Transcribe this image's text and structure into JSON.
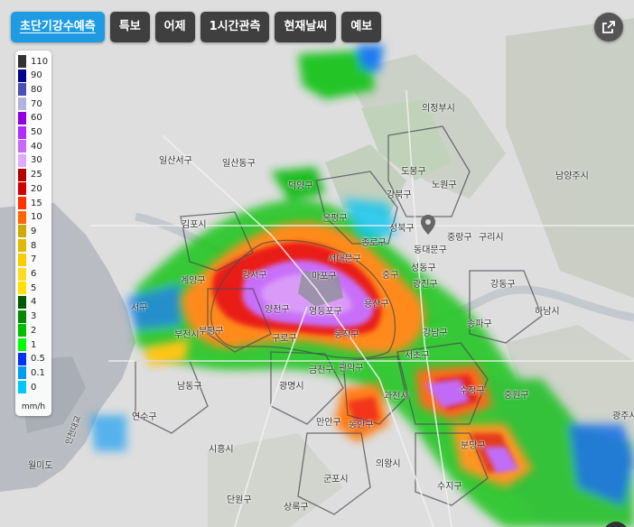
{
  "tabs": [
    {
      "label": "초단기강수예측",
      "active": true
    },
    {
      "label": "특보",
      "active": false
    },
    {
      "label": "어제",
      "active": false
    },
    {
      "label": "1시간관측",
      "active": false
    },
    {
      "label": "현재날씨",
      "active": false
    },
    {
      "label": "예보",
      "active": false
    }
  ],
  "external_icon": "external-link-icon",
  "legend": {
    "unit": "mm/h",
    "items": [
      {
        "label": "110",
        "color": "#333333"
      },
      {
        "label": "90",
        "color": "#000390"
      },
      {
        "label": "80",
        "color": "#4c4eb1"
      },
      {
        "label": "70",
        "color": "#b3b4de"
      },
      {
        "label": "60",
        "color": "#9300e4"
      },
      {
        "label": "50",
        "color": "#b329ff"
      },
      {
        "label": "40",
        "color": "#c969ff"
      },
      {
        "label": "30",
        "color": "#e0a9ff"
      },
      {
        "label": "25",
        "color": "#b40000"
      },
      {
        "label": "20",
        "color": "#d20000"
      },
      {
        "label": "15",
        "color": "#ff3200"
      },
      {
        "label": "10",
        "color": "#ff6600"
      },
      {
        "label": "9",
        "color": "#ccaa00"
      },
      {
        "label": "8",
        "color": "#e0b900"
      },
      {
        "label": "7",
        "color": "#f9cd00"
      },
      {
        "label": "6",
        "color": "#ffdc1f"
      },
      {
        "label": "5",
        "color": "#ffe100"
      },
      {
        "label": "4",
        "color": "#005a00"
      },
      {
        "label": "3",
        "color": "#008c00"
      },
      {
        "label": "2",
        "color": "#00be00"
      },
      {
        "label": "1",
        "color": "#00ff00"
      },
      {
        "label": "0.5",
        "color": "#0033f5"
      },
      {
        "label": "0.1",
        "color": "#009bf5"
      },
      {
        "label": "0",
        "color": "#00c8ff"
      }
    ]
  },
  "places": [
    {
      "name": "의정부시",
      "id": "uijeongbu"
    },
    {
      "name": "일산서구",
      "id": "ilsanseo"
    },
    {
      "name": "일산동구",
      "id": "ilsandong"
    },
    {
      "name": "덕양구",
      "id": "deogyang"
    },
    {
      "name": "남양주시",
      "id": "namyangju"
    },
    {
      "name": "도봉구",
      "id": "dobong"
    },
    {
      "name": "노원구",
      "id": "nowon"
    },
    {
      "name": "강북구",
      "id": "gangbuk"
    },
    {
      "name": "은평구",
      "id": "eunpyeong"
    },
    {
      "name": "성북구",
      "id": "seongbuk"
    },
    {
      "name": "동대문구",
      "id": "dongdaemun"
    },
    {
      "name": "중랑구",
      "id": "jungnang"
    },
    {
      "name": "구리시",
      "id": "guri"
    },
    {
      "name": "김포시",
      "id": "gimpo"
    },
    {
      "name": "종로구",
      "id": "jongno"
    },
    {
      "name": "서대문구",
      "id": "seodaemun"
    },
    {
      "name": "중구",
      "id": "junggu"
    },
    {
      "name": "광진구",
      "id": "gwangjin"
    },
    {
      "name": "성동구",
      "id": "seongdong"
    },
    {
      "name": "강동구",
      "id": "gangdong"
    },
    {
      "name": "계양구",
      "id": "gyeyang"
    },
    {
      "name": "강서구",
      "id": "gangseo"
    },
    {
      "name": "마포구",
      "id": "mapo"
    },
    {
      "name": "하남시",
      "id": "hanam"
    },
    {
      "name": "서구",
      "id": "seogu"
    },
    {
      "name": "양천구",
      "id": "yangcheon"
    },
    {
      "name": "영등포구",
      "id": "yeongdeungpo"
    },
    {
      "name": "용산구",
      "id": "yongsan"
    },
    {
      "name": "부평구",
      "id": "bupyeong"
    },
    {
      "name": "송파구",
      "id": "songpa"
    },
    {
      "name": "강남구",
      "id": "gangnam"
    },
    {
      "name": "동작구",
      "id": "dongjak"
    },
    {
      "name": "구로구",
      "id": "guro"
    },
    {
      "name": "부천시",
      "id": "bucheon"
    },
    {
      "name": "서초구",
      "id": "seocho"
    },
    {
      "name": "남동구",
      "id": "namdong"
    },
    {
      "name": "금천구",
      "id": "geumcheon"
    },
    {
      "name": "관악구",
      "id": "gwanak"
    },
    {
      "name": "광명시",
      "id": "gwangmyeong"
    },
    {
      "name": "과천시",
      "id": "gwacheon"
    },
    {
      "name": "수정구",
      "id": "sujeong"
    },
    {
      "name": "중원구",
      "id": "jungwon"
    },
    {
      "name": "광주시",
      "id": "gwangju"
    },
    {
      "name": "연수구",
      "id": "yeonsu"
    },
    {
      "name": "만안구",
      "id": "manan"
    },
    {
      "name": "동안구",
      "id": "dongan"
    },
    {
      "name": "분당구",
      "id": "bundang"
    },
    {
      "name": "시흥시",
      "id": "siheung"
    },
    {
      "name": "의왕시",
      "id": "uiwang"
    },
    {
      "name": "인천대교",
      "id": "incheon-bridge"
    },
    {
      "name": "월미도",
      "id": "wolmido"
    },
    {
      "name": "군포시",
      "id": "gunpo"
    },
    {
      "name": "수지구",
      "id": "suji"
    },
    {
      "name": "단원구",
      "id": "danwon"
    },
    {
      "name": "상록구",
      "id": "sangnok"
    }
  ]
}
